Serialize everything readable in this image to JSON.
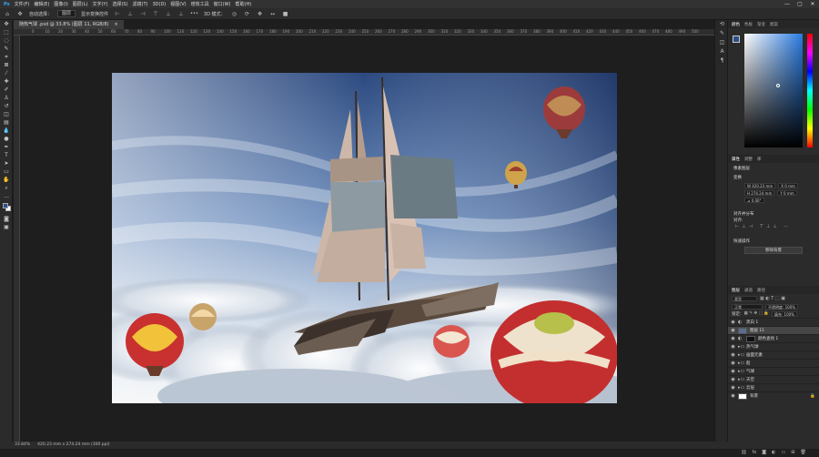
{
  "menu": [
    "文件(F)",
    "编辑(E)",
    "图像(I)",
    "图层(L)",
    "文字(Y)",
    "选择(S)",
    "滤镜(T)",
    "3D(D)",
    "视图(V)",
    "增效工具",
    "窗口(W)",
    "帮助(H)"
  ],
  "window_controls": {
    "minimize": "—",
    "maximize": "▢",
    "close": "✕"
  },
  "options": {
    "auto_select_label": "自动选择：",
    "auto_select_value": "图层",
    "show_transform": "显示变换控件",
    "more": "•••",
    "mode_3d": "3D 模式："
  },
  "doc_tab": {
    "title": "随热气球 .psd @ 33.8% (图层 11, RGB/8)",
    "close": "×"
  },
  "ruler_ticks": [
    "0",
    "10",
    "20",
    "30",
    "40",
    "50",
    "60",
    "70",
    "80",
    "90",
    "100",
    "110",
    "120",
    "130",
    "140",
    "150",
    "160",
    "170",
    "180",
    "190",
    "200",
    "210",
    "220",
    "230",
    "240",
    "250",
    "260",
    "270",
    "280",
    "290",
    "300",
    "310",
    "320",
    "330",
    "340",
    "350",
    "360",
    "370",
    "380",
    "390",
    "400",
    "410",
    "420",
    "430",
    "440",
    "450",
    "460",
    "470",
    "480",
    "490",
    "500"
  ],
  "status": {
    "zoom": "33.84%",
    "dims": "420.23 mm x 274.24 mm (300 ppi)"
  },
  "panel_color_tabs": [
    "颜色",
    "色板",
    "渐变",
    "图案"
  ],
  "panel_props_tabs": [
    "属性",
    "调整",
    "库"
  ],
  "props": {
    "title": "像素图层",
    "transform_label": "变换",
    "w": "W 420.23 mm",
    "x": "X 0 mm",
    "h": "H 274.24 mm",
    "y": "Y 0 mm",
    "angle": "⊿ 0.00°",
    "align_label": "对齐并分布",
    "align_sub": "对齐:",
    "quick_label": "快速操作",
    "remove_bg": "移除背景"
  },
  "layers_tabs": [
    "图层",
    "通道",
    "路径"
  ],
  "layers_search": "类型",
  "layers_blend": "正常",
  "layers_opacity": "不透明度: 100%",
  "layers_lock": "锁定:",
  "layers_fill": "填充: 100%",
  "layers": [
    {
      "name": "黑白 1",
      "kind": "adjust"
    },
    {
      "name": "图层 11",
      "kind": "pixel",
      "selected": true
    },
    {
      "name": "颜色查找 1",
      "kind": "adjust"
    },
    {
      "name": "热气球",
      "kind": "folder"
    },
    {
      "name": "画面元素",
      "kind": "folder"
    },
    {
      "name": "船",
      "kind": "folder"
    },
    {
      "name": "气球",
      "kind": "folder"
    },
    {
      "name": "天空",
      "kind": "folder"
    },
    {
      "name": "云层",
      "kind": "folder"
    },
    {
      "name": "背景",
      "kind": "pixel"
    }
  ],
  "colors": {
    "accent": "#2a4f8a",
    "panel": "#2b2b2b"
  }
}
